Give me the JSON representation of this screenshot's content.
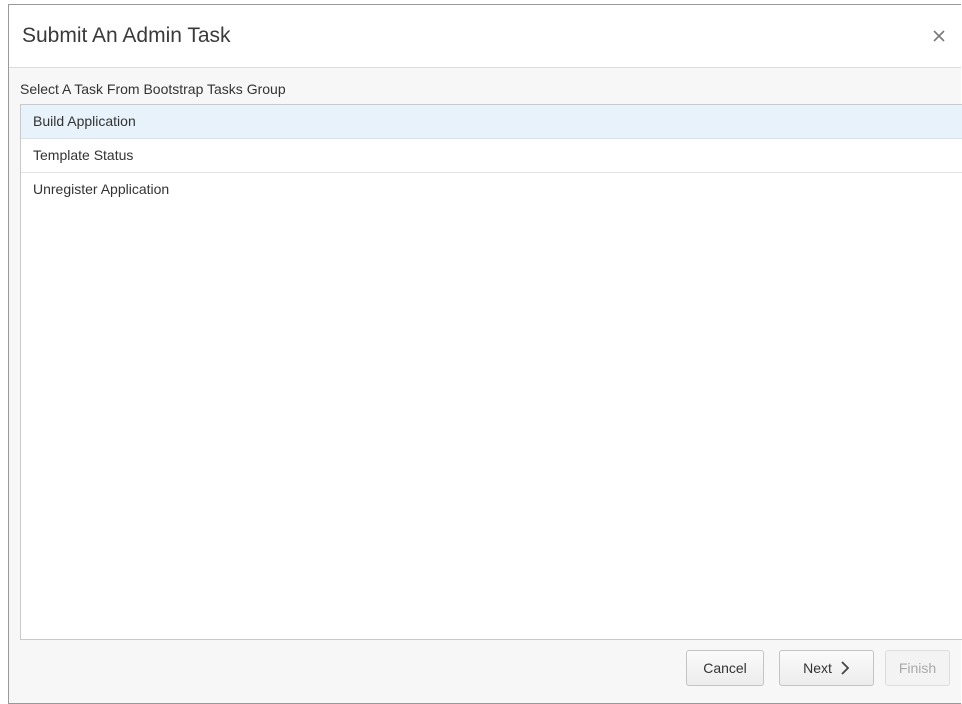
{
  "dialog": {
    "title": "Submit An Admin Task",
    "close_icon": "close-icon"
  },
  "task_group": {
    "label": "Select A Task From Bootstrap Tasks Group",
    "items": [
      {
        "label": "Build Application",
        "selected": true
      },
      {
        "label": "Template Status",
        "selected": false
      },
      {
        "label": "Unregister Application",
        "selected": false
      }
    ]
  },
  "footer": {
    "cancel_label": "Cancel",
    "next_label": "Next",
    "next_icon": "chevron-right-icon",
    "finish_label": "Finish",
    "finish_disabled": true
  },
  "colors": {
    "selected_row": "#e8f2fa",
    "border": "#c9c9c9",
    "disabled_text": "#a9a9a9"
  }
}
